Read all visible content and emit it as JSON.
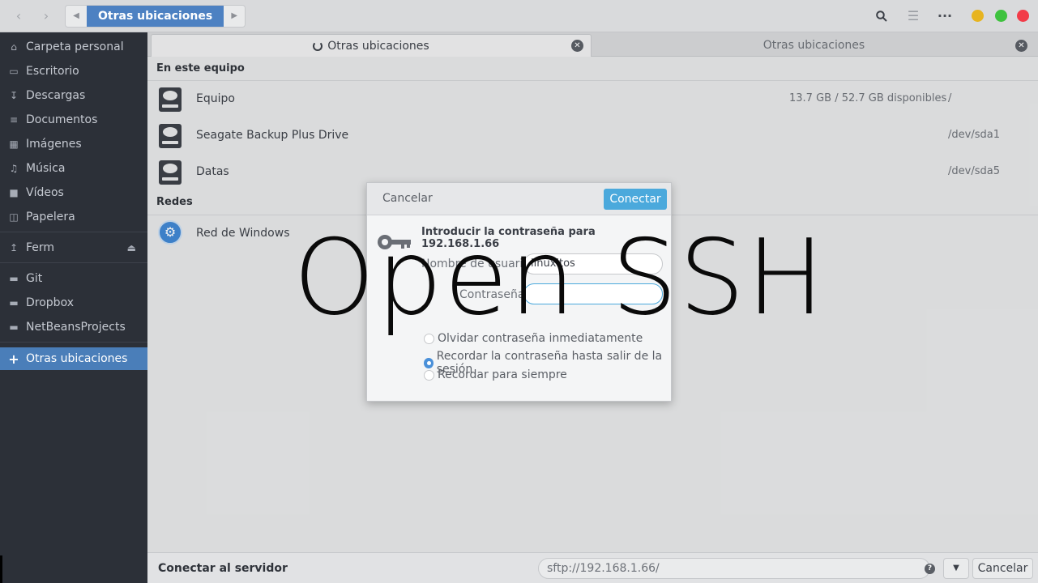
{
  "header": {
    "back_icon": "chevron-left-icon",
    "forward_icon": "chevron-right-icon",
    "path_current": "Otras ubicaciones",
    "colors": {
      "path_active": "#4d81c2",
      "minimize": "#e7b420",
      "maximize": "#3ec23e",
      "close": "#f23b48"
    }
  },
  "sidebar": {
    "items": [
      {
        "icon": "home-icon",
        "label": "Carpeta personal"
      },
      {
        "icon": "desktop-icon",
        "label": "Escritorio"
      },
      {
        "icon": "download-icon",
        "label": "Descargas"
      },
      {
        "icon": "document-icon",
        "label": "Documentos"
      },
      {
        "icon": "image-icon",
        "label": "Imágenes"
      },
      {
        "icon": "music-icon",
        "label": "Música"
      },
      {
        "icon": "video-icon",
        "label": "Vídeos"
      },
      {
        "icon": "trash-icon",
        "label": "Papelera"
      },
      {
        "icon": "usb-icon",
        "label": "Ferm"
      },
      {
        "icon": "folder-icon",
        "label": "Git"
      },
      {
        "icon": "folder-icon",
        "label": "Dropbox"
      },
      {
        "icon": "folder-icon",
        "label": "NetBeansProjects"
      },
      {
        "icon": "plus-icon",
        "label": "Otras ubicaciones"
      }
    ],
    "active_color": "#4a7eb9"
  },
  "tabs": [
    {
      "label": "Otras ubicaciones",
      "active": true
    },
    {
      "label": "Otras ubicaciones",
      "active": false
    }
  ],
  "content": {
    "section_local": "En este equipo",
    "section_network": "Redes",
    "drives": [
      {
        "name": "Equipo",
        "info": "13.7 GB / 52.7 GB disponibles",
        "path": "/"
      },
      {
        "name": "Seagate Backup Plus Drive",
        "info": "",
        "path": "/dev/sda1"
      },
      {
        "name": "Datas",
        "info": "",
        "path": "/dev/sda5"
      }
    ],
    "network": [
      {
        "name": "Red de Windows"
      }
    ]
  },
  "bottombar": {
    "label": "Conectar al servidor",
    "server_value": "sftp://192.168.1.66/",
    "cancel": "Cancelar"
  },
  "dialog": {
    "cancel": "Cancelar",
    "connect": "Conectar",
    "title": "Introducir la contraseña para 192.168.1.66",
    "username_label": "Nombre de usuario",
    "username_value": "linuxitos",
    "password_label": "Contraseña",
    "password_value": "",
    "options": [
      {
        "label": "Olvidar contraseña inmediatamente",
        "selected": false
      },
      {
        "label": "Recordar la contraseña hasta salir de la sesión",
        "selected": true
      },
      {
        "label": "Recordar para siempre",
        "selected": false
      }
    ],
    "accent": "#4ba9dc"
  },
  "watermark": "Open SSH"
}
